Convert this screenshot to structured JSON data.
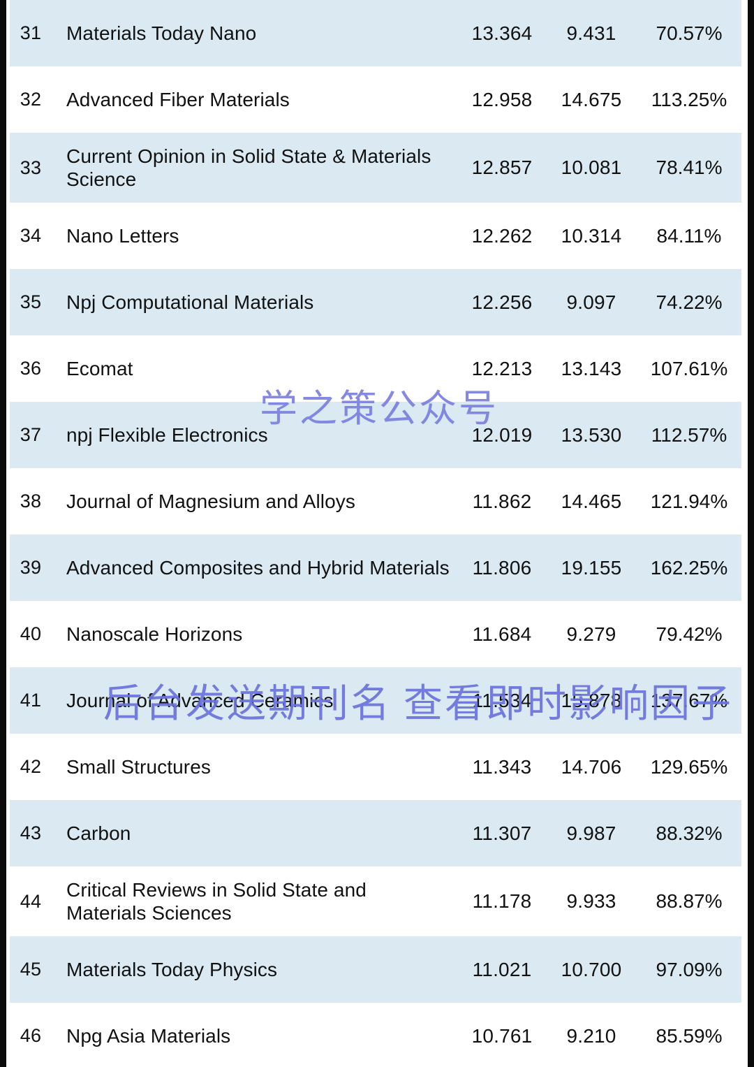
{
  "table": {
    "columns": [
      "rank",
      "journal",
      "impact_factor",
      "secondary_value",
      "percent"
    ],
    "rows": [
      {
        "rank": "31",
        "journal": "Materials Today Nano",
        "impact_factor": "13.364",
        "secondary_value": "9.431",
        "percent": "70.57%",
        "shaded": true
      },
      {
        "rank": "32",
        "journal": "Advanced Fiber Materials",
        "impact_factor": "12.958",
        "secondary_value": "14.675",
        "percent": "113.25%",
        "shaded": false
      },
      {
        "rank": "33",
        "journal": "Current Opinion in Solid State & Materials Science",
        "impact_factor": "12.857",
        "secondary_value": "10.081",
        "percent": "78.41%",
        "shaded": true
      },
      {
        "rank": "34",
        "journal": "Nano Letters",
        "impact_factor": "12.262",
        "secondary_value": "10.314",
        "percent": "84.11%",
        "shaded": false
      },
      {
        "rank": "35",
        "journal": "Npj Computational Materials",
        "impact_factor": "12.256",
        "secondary_value": "9.097",
        "percent": "74.22%",
        "shaded": true
      },
      {
        "rank": "36",
        "journal": "Ecomat",
        "impact_factor": "12.213",
        "secondary_value": "13.143",
        "percent": "107.61%",
        "shaded": false
      },
      {
        "rank": "37",
        "journal": "npj Flexible Electronics",
        "impact_factor": "12.019",
        "secondary_value": "13.530",
        "percent": "112.57%",
        "shaded": true
      },
      {
        "rank": "38",
        "journal": "Journal of Magnesium and Alloys",
        "impact_factor": "11.862",
        "secondary_value": "14.465",
        "percent": "121.94%",
        "shaded": false
      },
      {
        "rank": "39",
        "journal": "Advanced Composites and Hybrid Materials",
        "impact_factor": "11.806",
        "secondary_value": "19.155",
        "percent": "162.25%",
        "shaded": true
      },
      {
        "rank": "40",
        "journal": "Nanoscale Horizons",
        "impact_factor": "11.684",
        "secondary_value": "9.279",
        "percent": "79.42%",
        "shaded": false
      },
      {
        "rank": "41",
        "journal": "Journal of Advanced Ceramics",
        "impact_factor": "11.534",
        "secondary_value": "15.878",
        "percent": "137.67%",
        "shaded": true
      },
      {
        "rank": "42",
        "journal": "Small Structures",
        "impact_factor": "11.343",
        "secondary_value": "14.706",
        "percent": "129.65%",
        "shaded": false
      },
      {
        "rank": "43",
        "journal": "Carbon",
        "impact_factor": "11.307",
        "secondary_value": "9.987",
        "percent": "88.32%",
        "shaded": true
      },
      {
        "rank": "44",
        "journal": "Critical Reviews in Solid State and Materials Sciences",
        "impact_factor": "11.178",
        "secondary_value": "9.933",
        "percent": "88.87%",
        "shaded": false
      },
      {
        "rank": "45",
        "journal": "Materials Today Physics",
        "impact_factor": "11.021",
        "secondary_value": "10.700",
        "percent": "97.09%",
        "shaded": true
      },
      {
        "rank": "46",
        "journal": "Npg Asia Materials",
        "impact_factor": "10.761",
        "secondary_value": "9.210",
        "percent": "85.59%",
        "shaded": false
      }
    ]
  },
  "watermarks": {
    "primary": "学之策公众号",
    "secondary": "后台发送期刊名 查看即时影响因子"
  },
  "colors": {
    "row_shaded": "#dbeaf2",
    "row_plain": "#ffffff",
    "text": "#111111",
    "watermark": "#7b7fe0",
    "edge_border": "#0b0b0b"
  }
}
